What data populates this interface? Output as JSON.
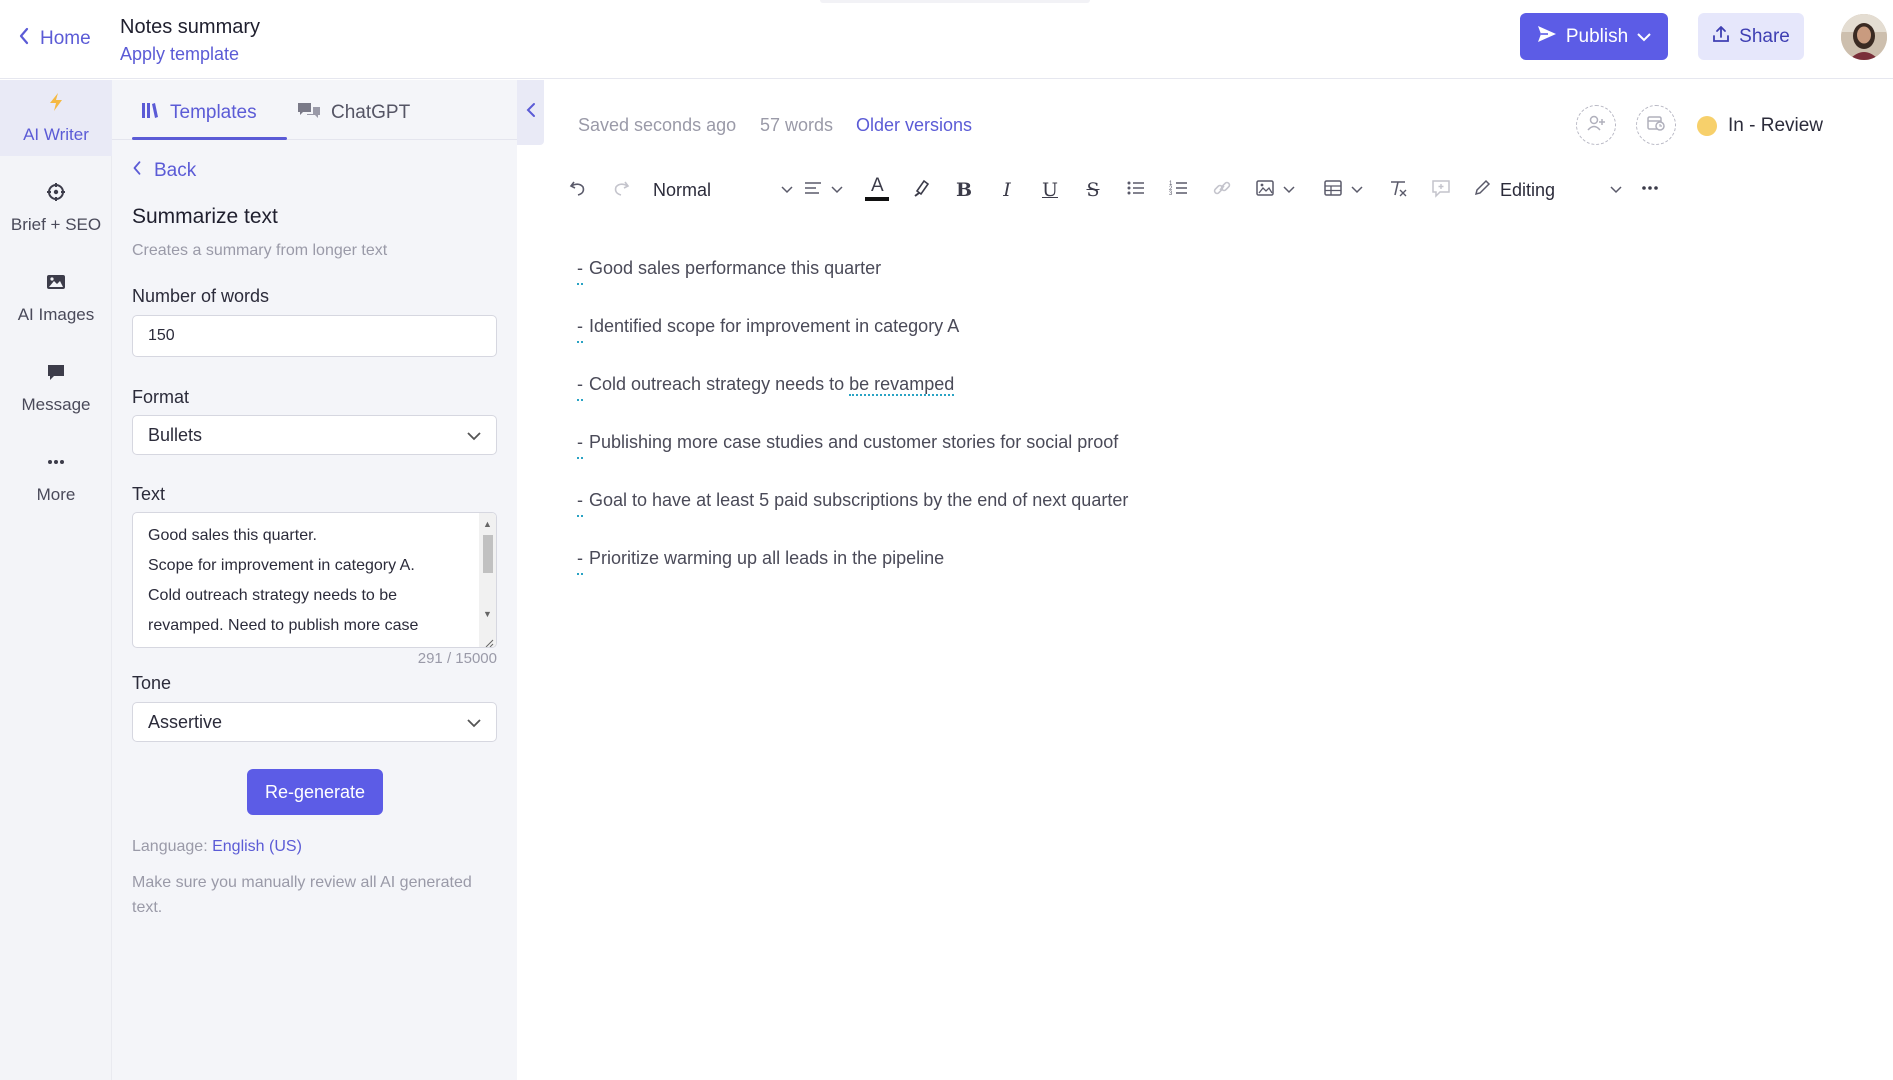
{
  "header": {
    "home_label": "Home",
    "doc_title": "Notes summary",
    "apply_template": "Apply template",
    "publish_label": "Publish",
    "share_label": "Share"
  },
  "rail": {
    "items": [
      {
        "label": "AI Writer",
        "icon": "lightning-icon"
      },
      {
        "label": "Brief + SEO",
        "icon": "crosshair-icon"
      },
      {
        "label": "AI Images",
        "icon": "image-icon"
      },
      {
        "label": "Message",
        "icon": "chat-bubble-icon"
      },
      {
        "label": "More",
        "icon": "more-dots-icon"
      }
    ]
  },
  "panel": {
    "tabs": [
      {
        "label": "Templates",
        "icon": "library-icon",
        "active": true
      },
      {
        "label": "ChatGPT",
        "icon": "chat-bubbles-icon",
        "active": false
      }
    ],
    "back_label": "Back",
    "section_title": "Summarize text",
    "section_desc": "Creates a summary from longer text",
    "words_label": "Number of words",
    "words_value": "150",
    "format_label": "Format",
    "format_value": "Bullets",
    "text_label": "Text",
    "text_lines": [
      "Good sales this quarter.",
      "Scope for improvement  in category A.",
      "Cold outreach strategy needs to be",
      "revamped. Need to publish more case"
    ],
    "char_count": "291 / 15000",
    "tone_label": "Tone",
    "tone_value": "Assertive",
    "regenerate_label": "Re-generate",
    "language_prefix": "Language:",
    "language_value": "English (US)",
    "disclaimer": "Make sure you manually review all AI generated text."
  },
  "editor": {
    "saved_status": "Saved seconds ago",
    "word_count": "57 words",
    "older_versions": "Older versions",
    "review_status": "In - Review",
    "review_color": "#f7d06b",
    "toolbar": {
      "paragraph_style": "Normal",
      "mode": "Editing"
    },
    "lines": [
      {
        "dash": "-",
        "text": "Good sales performance this quarter"
      },
      {
        "dash": "-",
        "text": "Identified scope for improvement in category A"
      },
      {
        "dash": "-",
        "text": "Cold outreach strategy needs to ",
        "flagged": "be revamped"
      },
      {
        "dash": "-",
        "text": "Publishing more case studies and customer stories for social proof"
      },
      {
        "dash": "-",
        "text": "Goal to have at least 5 paid subscriptions by the end of next quarter"
      },
      {
        "dash": "-",
        "text": "Prioritize warming up all leads in the pipeline"
      }
    ]
  },
  "colors": {
    "accent": "#5c5ce6",
    "accent_text": "#5b5bd6",
    "spellcheck": "#2aa3c4"
  }
}
